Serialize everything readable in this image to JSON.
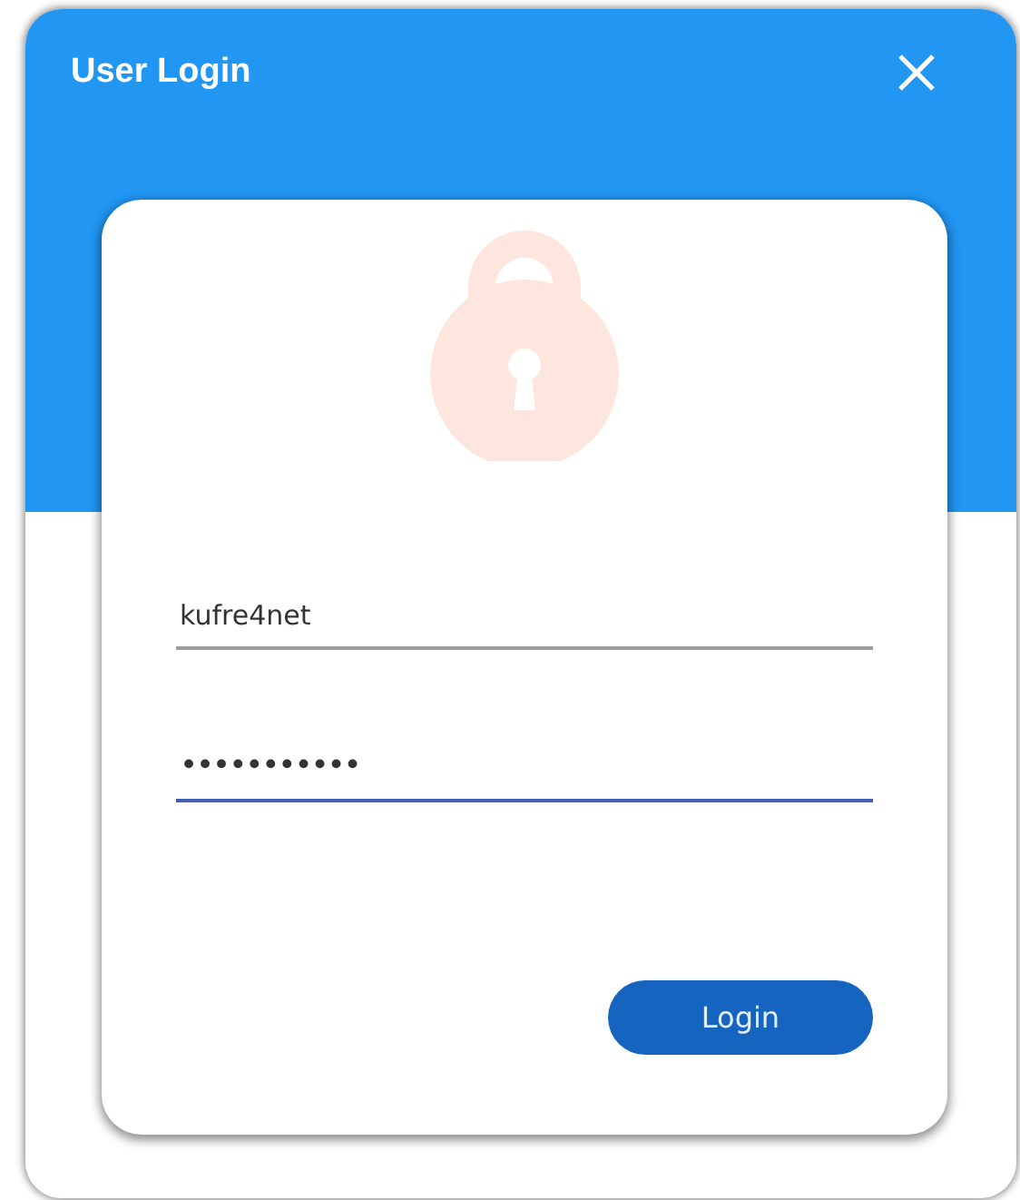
{
  "window": {
    "title": "User Login"
  },
  "fields": [
    {
      "kind": "text",
      "value": "kufre4net",
      "focused": false
    },
    {
      "kind": "password",
      "value": "•••••••••••",
      "focused": true
    }
  ],
  "buttons": [
    {
      "label": "Login"
    }
  ]
}
